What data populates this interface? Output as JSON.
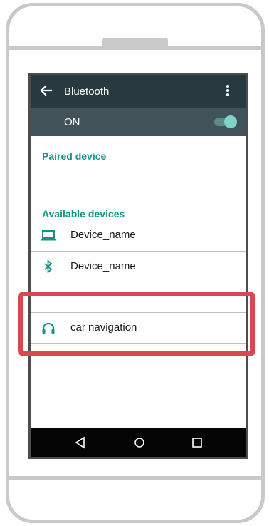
{
  "app_bar": {
    "title": "Bluetooth"
  },
  "bluetooth_toggle": {
    "label": "ON",
    "state": "on"
  },
  "sections": {
    "paired_title": "Paired device",
    "available_title": "Available devices"
  },
  "devices": [
    {
      "icon": "laptop-icon",
      "name": "Device_name"
    },
    {
      "icon": "bluetooth-icon",
      "name": "Device_name"
    },
    {
      "icon": "headphones-icon",
      "name": "car navigation"
    }
  ],
  "nav_bar": {
    "buttons": [
      "back-triangle-icon",
      "home-circle-icon",
      "recents-square-icon"
    ]
  },
  "colors": {
    "app_bar": "#283a40",
    "toggle_bar": "#415259",
    "accent_teal": "#139488",
    "highlight_red": "#d9484e"
  }
}
